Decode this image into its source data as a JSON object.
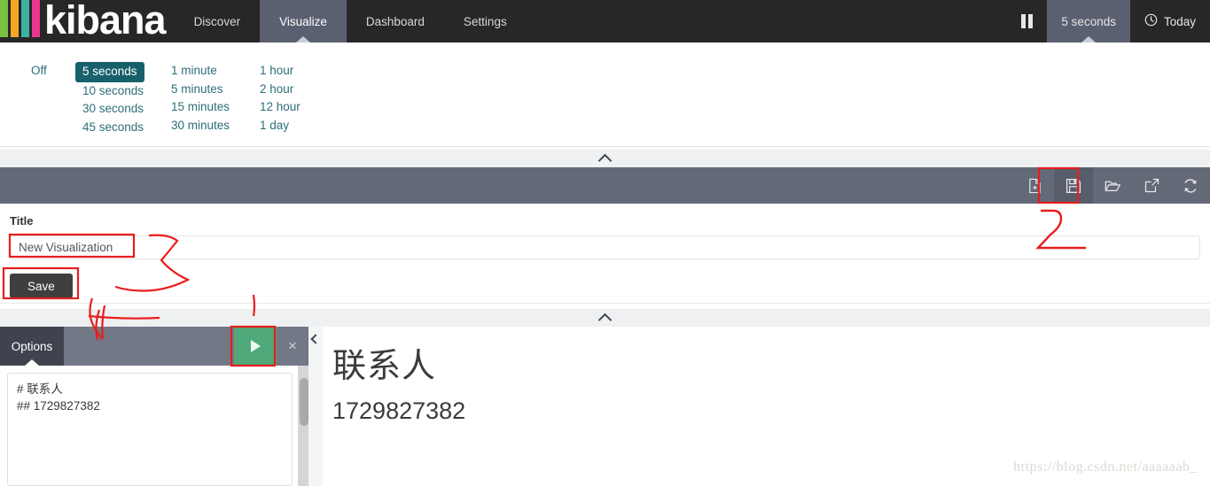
{
  "navbar": {
    "brand": "kibana",
    "brand_bar_colors": [
      "#7ac143",
      "#f5a623",
      "#3ab3a5",
      "#e8368f"
    ],
    "tabs": [
      {
        "label": "Discover",
        "active": false
      },
      {
        "label": "Visualize",
        "active": true
      },
      {
        "label": "Dashboard",
        "active": false
      },
      {
        "label": "Settings",
        "active": false
      }
    ],
    "pause_icon": "pause-icon",
    "refresh_interval": "5 seconds",
    "clock_icon": "clock-icon",
    "time_range": "Today"
  },
  "interval_panel": {
    "columns": [
      {
        "items": [
          {
            "label": "Off",
            "selected": false
          }
        ]
      },
      {
        "items": [
          {
            "label": "5 seconds",
            "selected": true
          },
          {
            "label": "10 seconds",
            "selected": false
          },
          {
            "label": "30 seconds",
            "selected": false
          },
          {
            "label": "45 seconds",
            "selected": false
          }
        ]
      },
      {
        "items": [
          {
            "label": "1 minute",
            "selected": false
          },
          {
            "label": "5 minutes",
            "selected": false
          },
          {
            "label": "15 minutes",
            "selected": false
          },
          {
            "label": "30 minutes",
            "selected": false
          }
        ]
      },
      {
        "items": [
          {
            "label": "1 hour",
            "selected": false
          },
          {
            "label": "2 hour",
            "selected": false
          },
          {
            "label": "12 hour",
            "selected": false
          },
          {
            "label": "1 day",
            "selected": false
          }
        ]
      }
    ],
    "selected_color": "#17616b",
    "link_color": "#2d6e79"
  },
  "toolbar": {
    "buttons": [
      {
        "icon": "new-document-icon",
        "highlighted": false
      },
      {
        "icon": "save-floppy-icon",
        "highlighted": true
      },
      {
        "icon": "open-folder-icon",
        "highlighted": false
      },
      {
        "icon": "share-external-icon",
        "highlighted": false
      },
      {
        "icon": "refresh-icon",
        "highlighted": false
      }
    ]
  },
  "save_form": {
    "label": "Title",
    "title_value": "New Visualization",
    "title_placeholder": "New Visualization",
    "save_label": "Save"
  },
  "editor": {
    "options_tab": "Options",
    "apply_icon": "play-triangle-icon",
    "apply_color": "#4fa97a",
    "close_icon": "close-icon",
    "close_glyph": "×",
    "markdown_source": "# 联系人\n## 1729827382",
    "collapse_icon": "chevron-left-icon"
  },
  "output": {
    "heading1": "联系人",
    "heading2": "1729827382"
  },
  "watermark": "https://blog.csdn.net/aaaaaab_",
  "collapse_bars": {
    "icon": "chevron-up-icon"
  },
  "annotations": {
    "color": "#e81d1d",
    "marker_label": "2"
  }
}
